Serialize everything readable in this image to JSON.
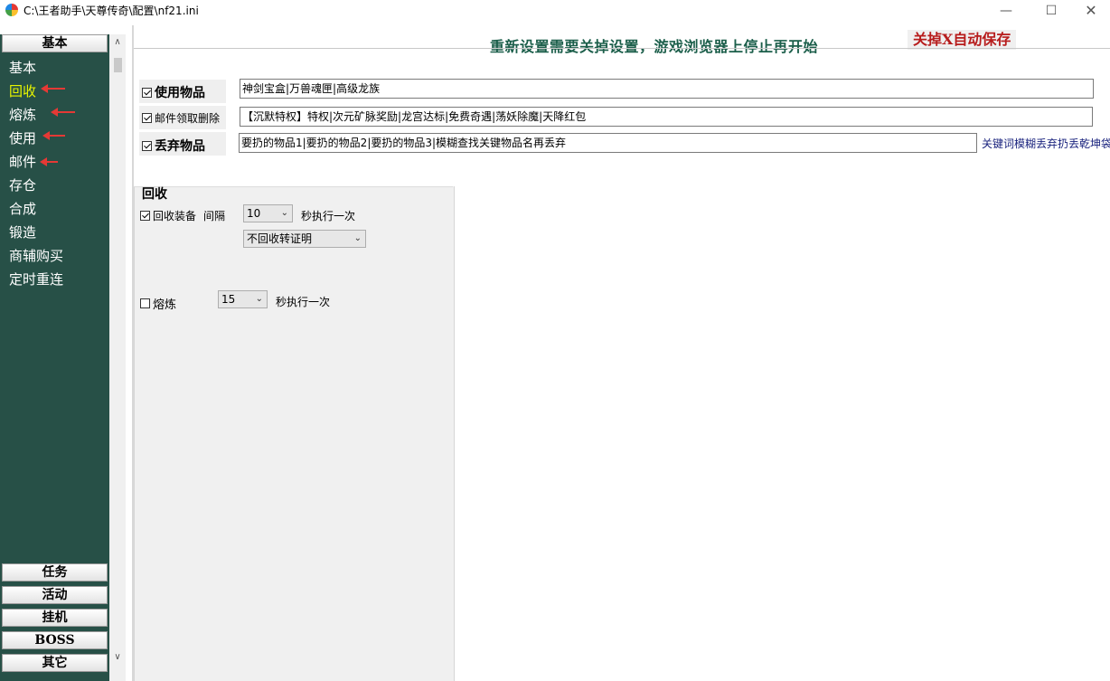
{
  "window": {
    "title": "C:\\王者助手\\天尊传奇\\配置\\nf21.ini",
    "minimize": "—",
    "maximize": "☐",
    "close": "✕"
  },
  "notice": {
    "main": "重新设置需要关掉设置，游戏浏览器上停止再开始",
    "red": "关掉X自动保存"
  },
  "sidebar": {
    "header_top": "基本",
    "items": [
      "基本",
      "回收",
      "熔炼",
      "使用",
      "邮件",
      "存仓",
      "合成",
      "锻造",
      "商辅购买",
      "定时重连"
    ],
    "active_item": "回收",
    "bottom_headers": [
      "任务",
      "活动",
      "挂机",
      "BOSS",
      "其它"
    ],
    "scroll_up": "∧",
    "scroll_down": "∨"
  },
  "rows": {
    "use_items": {
      "label": "使用物品",
      "checked": true,
      "value": "神剑宝盒|万兽魂匣|高级龙族"
    },
    "mail": {
      "label": "邮件领取删除",
      "checked": true,
      "value": "【沉默特权】特权|次元矿脉奖励|龙宫达标|免费奇遇|荡妖除魔|天降红包"
    },
    "discard": {
      "label": "丢弃物品",
      "checked": true,
      "value": "要扔的物品1|要扔的物品2|要扔的物品3|模糊查找关键物品名再丢弃",
      "hint": "关键词模糊丢弃扔丢乾坤袋"
    }
  },
  "recycle": {
    "group_title": "回收",
    "equip_label": "回收装备",
    "interval_label": "间隔",
    "equip_checked": true,
    "interval_value": "10",
    "per_sec": "秒执行一次",
    "mode_value": "不回收转证明",
    "smelt_label": "熔炼",
    "smelt_checked": false,
    "smelt_interval": "15",
    "smelt_per_sec": "秒执行一次"
  }
}
